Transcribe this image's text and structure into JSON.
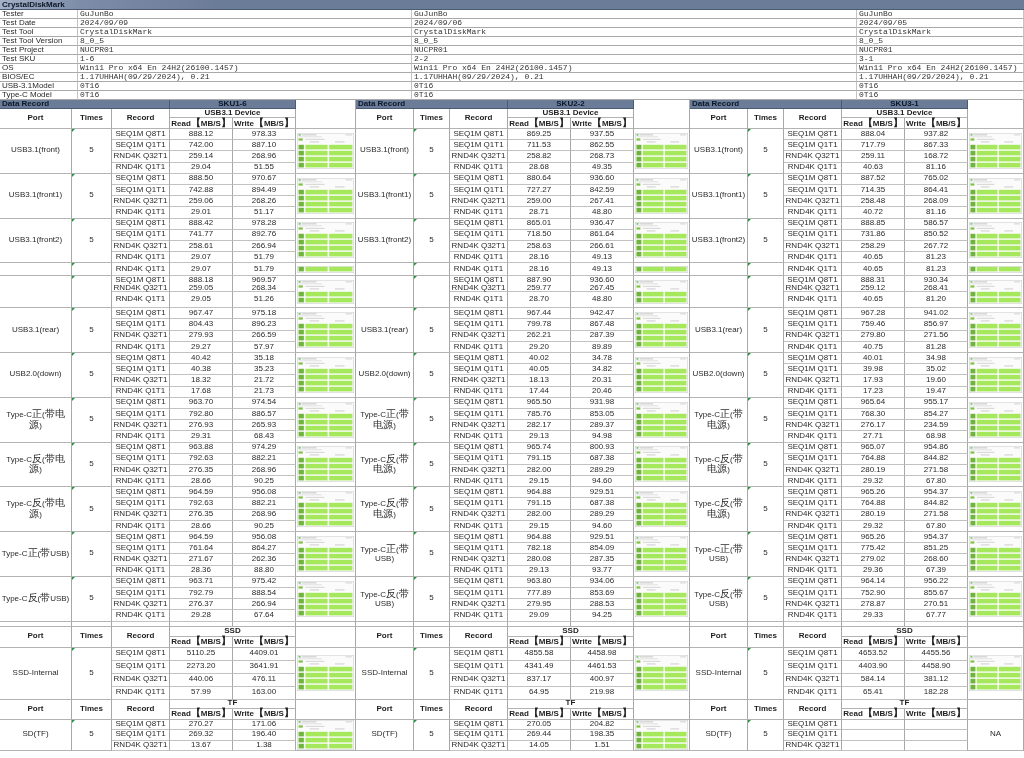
{
  "title": "CrystalDiskMark",
  "info_rows": [
    {
      "label": "Tester",
      "values": [
        "GuJunBo",
        "GuJunBo",
        "GuJunBo"
      ]
    },
    {
      "label": "Test Date",
      "values": [
        "2024/09/09",
        "2024/09/06",
        "2024/09/05"
      ]
    },
    {
      "label": "Test Tool",
      "values": [
        "CrystalDiskMark",
        "CrystalDiskMark",
        "CrystalDiskMark"
      ]
    },
    {
      "label": "Test Tool Version",
      "values": [
        "8_0_5",
        "8_0_5",
        "8_0_5"
      ]
    },
    {
      "label": "Test Project",
      "values": [
        "NUCPR01",
        "NUCPR01",
        "NUCPR01"
      ]
    },
    {
      "label": "Test SKU",
      "values": [
        "1-6",
        "2-2",
        "3-1"
      ]
    },
    {
      "label": "OS",
      "values": [
        "Win11 Pro x64 En 24H2(26100.1457)",
        "Win11 Pro x64 En 24H2(26100.1457)",
        "Win11 Pro x64 En 24H2(26100.1457)"
      ]
    },
    {
      "label": "BIOS/EC",
      "values": [
        "1.17UHHAH(09/29/2024), 0.21",
        "1.17UHHAH(09/29/2024), 0.21",
        "1.17UHHAH(09/29/2024), 0.21"
      ]
    },
    {
      "label": "USB-3.1Model",
      "values": [
        "0T16",
        "0T16",
        "0T16"
      ]
    },
    {
      "label": "Type-C Model",
      "values": [
        "0T16",
        "0T16",
        "0T16"
      ]
    }
  ],
  "blocks": [
    {
      "usb": {
        "band": "Data Record",
        "sku": "SKU1-6",
        "device": "USB3.1 Device",
        "headers": [
          "Port",
          "Times",
          "Record",
          "Read【MB/S】",
          "Write【MB/S】"
        ],
        "groups": [
          {
            "port": "USB3.1(front)",
            "times": "5",
            "rows": [
              {
                "record": "SEQ1M Q8T1",
                "read": "888.12",
                "write": "978.33"
              },
              {
                "record": "SEQ1M Q1T1",
                "read": "742.00",
                "write": "887.10"
              },
              {
                "record": "RND4K Q32T1",
                "read": "259.14",
                "write": "268.96"
              },
              {
                "record": "RND4K Q1T1",
                "read": "29.04",
                "write": "51.55"
              }
            ]
          },
          {
            "port": "USB3.1(front1)",
            "times": "5",
            "rows": [
              {
                "record": "SEQ1M Q8T1",
                "read": "888.50",
                "write": "970.67"
              },
              {
                "record": "SEQ1M Q1T1",
                "read": "742.88",
                "write": "894.49"
              },
              {
                "record": "RND4K Q32T1",
                "read": "259.06",
                "write": "268.26"
              },
              {
                "record": "RND4K Q1T1",
                "read": "29.01",
                "write": "51.17"
              }
            ]
          },
          {
            "port": "USB3.1(front2)",
            "times": "5",
            "rows": [
              {
                "record": "SEQ1M Q8T1",
                "read": "888.42",
                "write": "978.28"
              },
              {
                "record": "SEQ1M Q1T1",
                "read": "741.77",
                "write": "892.76"
              },
              {
                "record": "RND4K Q32T1",
                "read": "258.61",
                "write": "266.94"
              },
              {
                "record": "RND4K Q1T1",
                "read": "29.07",
                "write": "51.79"
              }
            ]
          },
          {
            "rows": [
              {
                "record": "RND4K Q1T1",
                "read": "29.07",
                "write": "51.79"
              }
            ]
          },
          {
            "rows": [
              {
                "record": "SEQ1M Q8T1",
                "read": "888.18",
                "write": "969.57",
                "overlaid": {
                  "record": "RND4K Q32T1",
                  "read": "259.05",
                  "write": "268.34"
                }
              },
              {
                "record": "RND4K Q1T1",
                "read": "29.05",
                "write": "51.26"
              }
            ]
          },
          {
            "port": "USB3.1(rear)",
            "times": "5",
            "rows": [
              {
                "record": "SEQ1M Q8T1",
                "read": "967.47",
                "write": "975.18"
              },
              {
                "record": "SEQ1M Q1T1",
                "read": "804.43",
                "write": "896.23"
              },
              {
                "record": "RND4K Q32T1",
                "read": "279.93",
                "write": "266.59"
              },
              {
                "record": "RND4K Q1T1",
                "read": "29.27",
                "write": "57.97"
              }
            ]
          },
          {
            "port": "USB2.0(down)",
            "times": "5",
            "rows": [
              {
                "record": "SEQ1M Q8T1",
                "read": "40.42",
                "write": "35.18"
              },
              {
                "record": "SEQ1M Q1T1",
                "read": "40.38",
                "write": "35.23"
              },
              {
                "record": "RND4K Q32T1",
                "read": "18.32",
                "write": "21.72"
              },
              {
                "record": "RND4K Q1T1",
                "read": "17.68",
                "write": "21.73"
              }
            ]
          },
          {
            "port": "Type-C正(带电源)",
            "times": "5",
            "rows": [
              {
                "record": "SEQ1M Q8T1",
                "read": "963.70",
                "write": "974.54"
              },
              {
                "record": "SEQ1M Q1T1",
                "read": "792.80",
                "write": "886.57"
              },
              {
                "record": "RND4K Q32T1",
                "read": "276.93",
                "write": "265.93"
              },
              {
                "record": "RND4K Q1T1",
                "read": "29.31",
                "write": "68.43"
              }
            ]
          },
          {
            "port": "Type-C反(带电源)",
            "times": "5",
            "rows": [
              {
                "record": "SEQ1M Q8T1",
                "read": "963.88",
                "write": "974.29"
              },
              {
                "record": "SEQ1M Q1T1",
                "read": "792.63",
                "write": "882.21"
              },
              {
                "record": "RND4K Q32T1",
                "read": "276.35",
                "write": "268.96"
              },
              {
                "record": "RND4K Q1T1",
                "read": "28.66",
                "write": "90.25"
              }
            ]
          },
          {
            "port": "Type-C反(带电源)",
            "times": "5",
            "rows": [
              {
                "record": "SEQ1M Q8T1",
                "read": "964.59",
                "write": "956.08"
              },
              {
                "record": "SEQ1M Q1T1",
                "read": "792.63",
                "write": "882.21"
              },
              {
                "record": "RND4K Q32T1",
                "read": "276.35",
                "write": "268.96"
              },
              {
                "record": "RND4K Q1T1",
                "read": "28.66",
                "write": "90.25"
              }
            ]
          },
          {
            "port": "Type-C正(带USB)",
            "times": "5",
            "rows": [
              {
                "record": "SEQ1M Q8T1",
                "read": "964.59",
                "write": "956.08"
              },
              {
                "record": "SEQ1M Q1T1",
                "read": "761.64",
                "write": "864.27"
              },
              {
                "record": "RND4K Q32T1",
                "read": "271.67",
                "write": "262.36"
              },
              {
                "record": "RND4K Q1T1",
                "read": "28.36",
                "write": "88.80"
              }
            ]
          },
          {
            "port": "Type-C反(带USB)",
            "times": "5",
            "rows": [
              {
                "record": "SEQ1M Q8T1",
                "read": "963.71",
                "write": "975.42"
              },
              {
                "record": "SEQ1M Q1T1",
                "read": "792.79",
                "write": "888.54"
              },
              {
                "record": "RND4K Q32T1",
                "read": "276.37",
                "write": "266.94"
              },
              {
                "record": "RND4K Q1T1",
                "read": "29.28",
                "write": "67.64"
              }
            ]
          }
        ]
      },
      "ssd": {
        "device": "SSD",
        "headers": [
          "Port",
          "Times",
          "Record",
          "Read【MB/S】",
          "Write【MB/S】"
        ],
        "group": {
          "port": "SSD-Internal",
          "times": "5",
          "rows": [
            {
              "record": "SEQ1M Q8T1",
              "read": "5110.25",
              "write": "4409.01"
            },
            {
              "record": "SEQ1M Q1T1",
              "read": "2273.20",
              "write": "3641.91"
            },
            {
              "record": "RND4K Q32T1",
              "read": "440.06",
              "write": "476.11"
            },
            {
              "record": "RND4K Q1T1",
              "read": "57.99",
              "write": "163.00"
            }
          ]
        }
      },
      "tf": {
        "device": "TF",
        "headers": [
          "Port",
          "Times",
          "Record",
          "Read【MB/S】",
          "Write【MB/S】"
        ],
        "group": {
          "port": "SD(TF)",
          "times": "5",
          "rows": [
            {
              "record": "SEQ1M Q8T1",
              "read": "270.27",
              "write": "171.06"
            },
            {
              "record": "SEQ1M Q1T1",
              "read": "269.32",
              "write": "196.40"
            },
            {
              "record": "RND4K Q32T1",
              "read": "13.67",
              "write": "1.38"
            }
          ]
        }
      }
    },
    {
      "usb": {
        "band": "Data Record",
        "sku": "SKU2-2",
        "device": "USB3.1 Device",
        "headers": [
          "Port",
          "Times",
          "Record",
          "Read【MB/S】",
          "Write【MB/S】"
        ],
        "groups": [
          {
            "port": "USB3.1(front)",
            "times": "5",
            "rows": [
              {
                "record": "SEQ1M Q8T1",
                "read": "869.25",
                "write": "937.55"
              },
              {
                "record": "SEQ1M Q1T1",
                "read": "711.53",
                "write": "862.55"
              },
              {
                "record": "RND4K Q32T1",
                "read": "258.82",
                "write": "268.73"
              },
              {
                "record": "RND4K Q1T1",
                "read": "28.68",
                "write": "49.35"
              }
            ]
          },
          {
            "port": "USB3.1(front1)",
            "times": "5",
            "rows": [
              {
                "record": "SEQ1M Q8T1",
                "read": "880.64",
                "write": "936.60"
              },
              {
                "record": "SEQ1M Q1T1",
                "read": "727.27",
                "write": "842.59"
              },
              {
                "record": "RND4K Q32T1",
                "read": "259.00",
                "write": "267.41"
              },
              {
                "record": "RND4K Q1T1",
                "read": "28.71",
                "write": "48.80"
              }
            ]
          },
          {
            "port": "USB3.1(front2)",
            "times": "5",
            "rows": [
              {
                "record": "SEQ1M Q8T1",
                "read": "865.01",
                "write": "936.47"
              },
              {
                "record": "SEQ1M Q1T1",
                "read": "718.50",
                "write": "861.64"
              },
              {
                "record": "RND4K Q32T1",
                "read": "258.63",
                "write": "266.61"
              },
              {
                "record": "RND4K Q1T1",
                "read": "28.16",
                "write": "49.13"
              }
            ]
          },
          {
            "rows": [
              {
                "record": "RND4K Q1T1",
                "read": "28.16",
                "write": "49.13"
              }
            ]
          },
          {
            "rows": [
              {
                "record": "SEQ1M Q8T1",
                "read": "887.90",
                "write": "936.60",
                "overlaid": {
                  "record": "RND4K Q32T1",
                  "read": "259.77",
                  "write": "267.45"
                }
              },
              {
                "record": "RND4K Q1T1",
                "read": "28.70",
                "write": "48.80"
              }
            ]
          },
          {
            "port": "USB3.1(rear)",
            "times": "5",
            "rows": [
              {
                "record": "SEQ1M Q8T1",
                "read": "967.44",
                "write": "942.47"
              },
              {
                "record": "SEQ1M Q1T1",
                "read": "799.78",
                "write": "867.48"
              },
              {
                "record": "RND4K Q32T1",
                "read": "262.21",
                "write": "287.39"
              },
              {
                "record": "RND4K Q1T1",
                "read": "29.20",
                "write": "89.89"
              }
            ]
          },
          {
            "port": "USB2.0(down)",
            "times": "5",
            "rows": [
              {
                "record": "SEQ1M Q8T1",
                "read": "40.02",
                "write": "34.78"
              },
              {
                "record": "SEQ1M Q1T1",
                "read": "40.05",
                "write": "34.82"
              },
              {
                "record": "RND4K Q32T1",
                "read": "18.13",
                "write": "20.31"
              },
              {
                "record": "RND4K Q1T1",
                "read": "17.44",
                "write": "20.46"
              }
            ]
          },
          {
            "port": "Type-C正(带电源)",
            "times": "5",
            "rows": [
              {
                "record": "SEQ1M Q8T1",
                "read": "965.50",
                "write": "931.98"
              },
              {
                "record": "SEQ1M Q1T1",
                "read": "785.76",
                "write": "853.05"
              },
              {
                "record": "RND4K Q32T1",
                "read": "282.17",
                "write": "289.37"
              },
              {
                "record": "RND4K Q1T1",
                "read": "29.13",
                "write": "94.98"
              }
            ]
          },
          {
            "port": "Type-C反(带电源)",
            "times": "5",
            "rows": [
              {
                "record": "SEQ1M Q8T1",
                "read": "965.74",
                "write": "800.93"
              },
              {
                "record": "SEQ1M Q1T1",
                "read": "791.15",
                "write": "687.38"
              },
              {
                "record": "RND4K Q32T1",
                "read": "282.00",
                "write": "289.29"
              },
              {
                "record": "RND4K Q1T1",
                "read": "29.15",
                "write": "94.60"
              }
            ]
          },
          {
            "port": "Type-C反(带电源)",
            "times": "5",
            "rows": [
              {
                "record": "SEQ1M Q8T1",
                "read": "964.88",
                "write": "929.51"
              },
              {
                "record": "SEQ1M Q1T1",
                "read": "791.15",
                "write": "687.38"
              },
              {
                "record": "RND4K Q32T1",
                "read": "282.00",
                "write": "289.29"
              },
              {
                "record": "RND4K Q1T1",
                "read": "29.15",
                "write": "94.60"
              }
            ]
          },
          {
            "port": "Type-C正(带USB)",
            "times": "5",
            "rows": [
              {
                "record": "SEQ1M Q8T1",
                "read": "964.88",
                "write": "929.51"
              },
              {
                "record": "SEQ1M Q1T1",
                "read": "782.18",
                "write": "854.09"
              },
              {
                "record": "RND4K Q32T1",
                "read": "280.08",
                "write": "287.35"
              },
              {
                "record": "RND4K Q1T1",
                "read": "29.13",
                "write": "93.77"
              }
            ]
          },
          {
            "port": "Type-C反(带USB)",
            "times": "5",
            "rows": [
              {
                "record": "SEQ1M Q8T1",
                "read": "963.80",
                "write": "934.06"
              },
              {
                "record": "SEQ1M Q1T1",
                "read": "777.89",
                "write": "853.69"
              },
              {
                "record": "RND4K Q32T1",
                "read": "279.95",
                "write": "288.53"
              },
              {
                "record": "RND4K Q1T1",
                "read": "29.09",
                "write": "94.25"
              }
            ]
          }
        ]
      },
      "ssd": {
        "device": "SSD",
        "headers": [
          "Port",
          "Times",
          "Record",
          "Read【MB/S】",
          "Write【MB/S】"
        ],
        "group": {
          "port": "SSD-Internal",
          "times": "5",
          "rows": [
            {
              "record": "SEQ1M Q8T1",
              "read": "4855.58",
              "write": "4458.98"
            },
            {
              "record": "SEQ1M Q1T1",
              "read": "4341.49",
              "write": "4461.53"
            },
            {
              "record": "RND4K Q32T1",
              "read": "837.17",
              "write": "400.97"
            },
            {
              "record": "RND4K Q1T1",
              "read": "64.95",
              "write": "219.98"
            }
          ]
        }
      },
      "tf": {
        "device": "TF",
        "headers": [
          "Port",
          "Times",
          "Record",
          "Read【MB/S】",
          "Write【MB/S】"
        ],
        "group": {
          "port": "SD(TF)",
          "times": "5",
          "rows": [
            {
              "record": "SEQ1M Q8T1",
              "read": "270.05",
              "write": "204.82"
            },
            {
              "record": "SEQ1M Q1T1",
              "read": "269.44",
              "write": "198.35"
            },
            {
              "record": "RND4K Q32T1",
              "read": "14.05",
              "write": "1.51"
            }
          ]
        }
      }
    },
    {
      "usb": {
        "band": "Data Record",
        "sku": "SKU3-1",
        "device": "USB3.1 Device",
        "headers": [
          "Port",
          "Times",
          "Record",
          "Read【MB/S】",
          "Write【MB/S】"
        ],
        "groups": [
          {
            "port": "USB3.1(front)",
            "times": "5",
            "rows": [
              {
                "record": "SEQ1M Q8T1",
                "read": "888.04",
                "write": "937.82"
              },
              {
                "record": "SEQ1M Q1T1",
                "read": "717.79",
                "write": "867.33"
              },
              {
                "record": "RND4K Q32T1",
                "read": "259.11",
                "write": "168.72"
              },
              {
                "record": "RND4K Q1T1",
                "read": "40.63",
                "write": "81.16"
              }
            ]
          },
          {
            "port": "USB3.1(front1)",
            "times": "5",
            "rows": [
              {
                "record": "SEQ1M Q8T1",
                "read": "887.52",
                "write": "765.02"
              },
              {
                "record": "SEQ1M Q1T1",
                "read": "714.35",
                "write": "864.41"
              },
              {
                "record": "RND4K Q32T1",
                "read": "258.48",
                "write": "268.09"
              },
              {
                "record": "RND4K Q1T1",
                "read": "40.72",
                "write": "81.16"
              }
            ]
          },
          {
            "port": "USB3.1(front2)",
            "times": "5",
            "rows": [
              {
                "record": "SEQ1M Q8T1",
                "read": "888.85",
                "write": "586.57"
              },
              {
                "record": "SEQ1M Q1T1",
                "read": "731.86",
                "write": "850.52"
              },
              {
                "record": "RND4K Q32T1",
                "read": "258.29",
                "write": "267.72"
              },
              {
                "record": "RND4K Q1T1",
                "read": "40.65",
                "write": "81.23"
              }
            ]
          },
          {
            "rows": [
              {
                "record": "RND4K Q1T1",
                "read": "40.65",
                "write": "81.23"
              }
            ]
          },
          {
            "rows": [
              {
                "record": "SEQ1M Q8T1",
                "read": "888.31",
                "write": "930.34",
                "overlaid": {
                  "record": "RND4K Q32T1",
                  "read": "259.12",
                  "write": "268.41"
                }
              },
              {
                "record": "RND4K Q1T1",
                "read": "40.65",
                "write": "81.20"
              }
            ]
          },
          {
            "port": "USB3.1(rear)",
            "times": "5",
            "rows": [
              {
                "record": "SEQ1M Q8T1",
                "read": "967.28",
                "write": "941.02"
              },
              {
                "record": "SEQ1M Q1T1",
                "read": "759.46",
                "write": "856.97"
              },
              {
                "record": "RND4K Q32T1",
                "read": "279.80",
                "write": "271.56"
              },
              {
                "record": "RND4K Q1T1",
                "read": "40.75",
                "write": "81.28"
              }
            ]
          },
          {
            "port": "USB2.0(down)",
            "times": "5",
            "rows": [
              {
                "record": "SEQ1M Q8T1",
                "read": "40.01",
                "write": "34.98"
              },
              {
                "record": "SEQ1M Q1T1",
                "read": "39.98",
                "write": "35.02"
              },
              {
                "record": "RND4K Q32T1",
                "read": "17.93",
                "write": "19.60"
              },
              {
                "record": "RND4K Q1T1",
                "read": "17.23",
                "write": "19.47"
              }
            ]
          },
          {
            "port": "Type-C正(带电源)",
            "times": "5",
            "rows": [
              {
                "record": "SEQ1M Q8T1",
                "read": "965.64",
                "write": "955.17"
              },
              {
                "record": "SEQ1M Q1T1",
                "read": "768.30",
                "write": "854.27"
              },
              {
                "record": "RND4K Q32T1",
                "read": "276.17",
                "write": "234.59"
              },
              {
                "record": "RND4K Q1T1",
                "read": "27.71",
                "write": "68.98"
              }
            ]
          },
          {
            "port": "Type-C反(带电源)",
            "times": "5",
            "rows": [
              {
                "record": "SEQ1M Q8T1",
                "read": "965.07",
                "write": "954.86"
              },
              {
                "record": "SEQ1M Q1T1",
                "read": "764.88",
                "write": "844.82"
              },
              {
                "record": "RND4K Q32T1",
                "read": "280.19",
                "write": "271.58"
              },
              {
                "record": "RND4K Q1T1",
                "read": "29.32",
                "write": "67.80"
              }
            ]
          },
          {
            "port": "Type-C反(带电源)",
            "times": "5",
            "rows": [
              {
                "record": "SEQ1M Q8T1",
                "read": "965.26",
                "write": "954.37"
              },
              {
                "record": "SEQ1M Q1T1",
                "read": "764.88",
                "write": "844.82"
              },
              {
                "record": "RND4K Q32T1",
                "read": "280.19",
                "write": "271.58"
              },
              {
                "record": "RND4K Q1T1",
                "read": "29.32",
                "write": "67.80"
              }
            ]
          },
          {
            "port": "Type-C正(带USB)",
            "times": "5",
            "rows": [
              {
                "record": "SEQ1M Q8T1",
                "read": "965.26",
                "write": "954.37"
              },
              {
                "record": "SEQ1M Q1T1",
                "read": "775.42",
                "write": "851.25"
              },
              {
                "record": "RND4K Q32T1",
                "read": "279.02",
                "write": "268.60"
              },
              {
                "record": "RND4K Q1T1",
                "read": "29.36",
                "write": "67.39"
              }
            ]
          },
          {
            "port": "Type-C反(带USB)",
            "times": "5",
            "rows": [
              {
                "record": "SEQ1M Q8T1",
                "read": "964.14",
                "write": "956.22"
              },
              {
                "record": "SEQ1M Q1T1",
                "read": "752.90",
                "write": "855.67"
              },
              {
                "record": "RND4K Q32T1",
                "read": "278.87",
                "write": "270.51"
              },
              {
                "record": "RND4K Q1T1",
                "read": "29.33",
                "write": "67.77"
              }
            ]
          }
        ]
      },
      "ssd": {
        "device": "SSD",
        "headers": [
          "Port",
          "Times",
          "Record",
          "Read【MB/S】",
          "Write【MB/S】"
        ],
        "group": {
          "port": "SSD-Internal",
          "times": "5",
          "rows": [
            {
              "record": "SEQ1M Q8T1",
              "read": "4653.52",
              "write": "4455.56"
            },
            {
              "record": "SEQ1M Q1T1",
              "read": "4403.90",
              "write": "4458.90"
            },
            {
              "record": "RND4K Q32T1",
              "read": "584.14",
              "write": "381.12"
            },
            {
              "record": "RND4K Q1T1",
              "read": "65.41",
              "write": "182.28"
            }
          ]
        }
      },
      "tf": {
        "device": "TF",
        "headers": [
          "Port",
          "Times",
          "Record",
          "Read【MB/S】",
          "Write【MB/S】"
        ],
        "group": {
          "port": "SD(TF)",
          "times": "5",
          "note": "NA",
          "rows": [
            {
              "record": "SEQ1M Q8T1"
            },
            {
              "record": "SEQ1M Q1T1"
            },
            {
              "record": "RND4K Q32T1"
            }
          ]
        }
      }
    }
  ]
}
